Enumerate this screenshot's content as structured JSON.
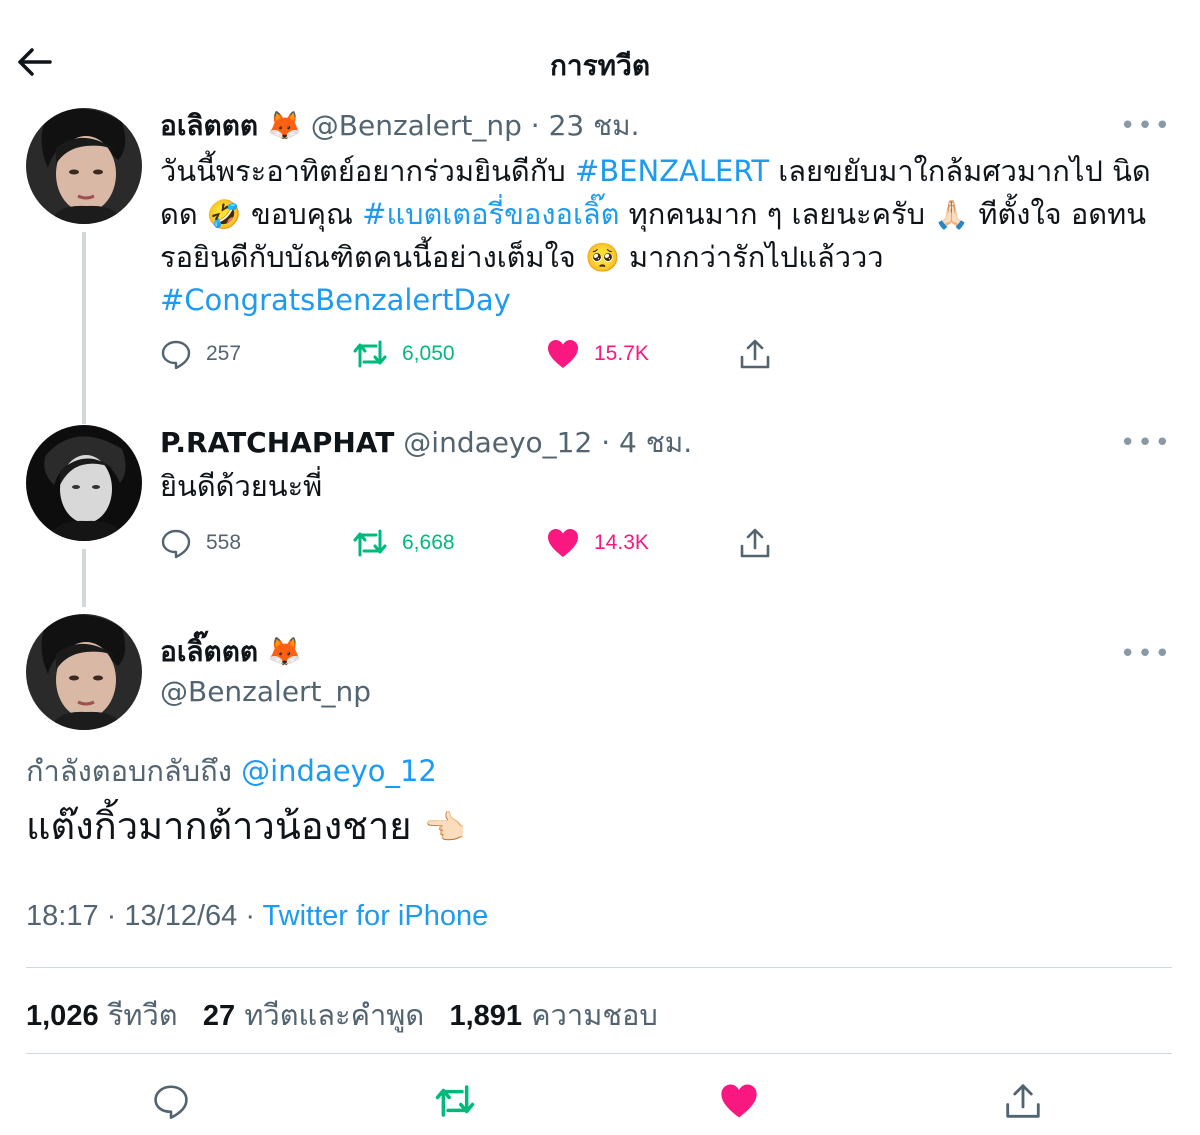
{
  "header": {
    "title": "การทวีต"
  },
  "thread": [
    {
      "name": "อเลิตตต",
      "name_emoji": "🦊",
      "handle": "@Benzalert_np",
      "time": "23 ชม.",
      "text_parts": {
        "p1": "วันนี้พระอาทิตย์อยากร่วมยินดีกับ ",
        "hashtag1": "#BENZALERT",
        "p2": " เลยขยับมาใกล้มศวมากไป นิดดด ",
        "emoji1": "🤣",
        "p3": " ขอบคุณ ",
        "hashtag2": "#แบตเตอรี่ของอเลิ๊ต",
        "p4": "  ทุกคนมาก ๆ เลยนะครับ ",
        "emoji2": "🙏🏻",
        "p5": " ทีตั้งใจ อดทน รอยินดีกับบัณฑิตคนนี้อย่างเต็มใจ ",
        "emoji3": "🥺",
        "p6": " มากกว่ารักไปแล้ววว",
        "hashtag3": "#CongratsBenzalertDay"
      },
      "replies": "257",
      "retweets": "6,050",
      "likes": "15.7K"
    },
    {
      "name": "P.RATCHAPHAT",
      "handle": "@indaeyo_12",
      "time": "4 ชม.",
      "text": "ยินดีด้วยนะพี่",
      "replies": "558",
      "retweets": "6,668",
      "likes": "14.3K"
    }
  ],
  "main_tweet": {
    "name": "อเลิ๊ตตต",
    "name_emoji": "🦊",
    "handle": "@Benzalert_np",
    "reply_prefix": "กำลังตอบกลับถึง",
    "reply_handle": "@indaeyo_12",
    "text": "แต๊งกิ้วมากต้าวน้องชาย",
    "text_emoji": "👈🏻",
    "time": "18:17",
    "date": "13/12/64",
    "source": "Twitter for iPhone",
    "retweets_count": "1,026",
    "retweets_label": "รีทวีต",
    "quotes_count": "27",
    "quotes_label": "ทวีตและคำพูด",
    "likes_count": "1,891",
    "likes_label": "ความชอบ"
  },
  "more_label": "•••",
  "dot_separator": "·",
  "colors": {
    "text": "#0f1419",
    "muted": "#536471",
    "link": "#1d9bf0",
    "retweet": "#00ba7c",
    "like": "#f91880",
    "divider": "#cfd9de"
  },
  "icons": [
    "back-arrow-icon",
    "reply-icon",
    "retweet-icon",
    "heart-icon",
    "share-icon",
    "more-icon"
  ]
}
